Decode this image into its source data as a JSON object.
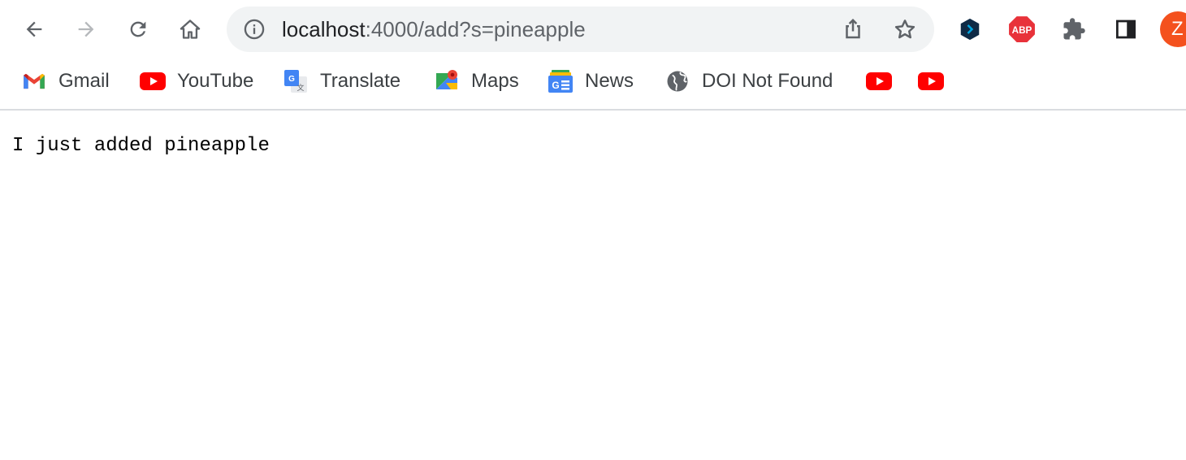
{
  "toolbar": {
    "back_icon": "arrow-left-icon",
    "forward_icon": "arrow-right-icon",
    "reload_icon": "reload-icon",
    "home_icon": "home-icon"
  },
  "omnibox": {
    "host": "localhost",
    "rest": ":4000/add?s=pineapple",
    "icons": [
      "info-icon",
      "share-icon",
      "star-icon"
    ]
  },
  "extensions": {
    "items": [
      "dark-extension-icon",
      "adblock-plus-icon",
      "puzzle-icon",
      "side-panel-icon"
    ],
    "abp_label": "ABP",
    "profile_initial": "Z"
  },
  "bookmarks": {
    "items": [
      {
        "label": "Gmail",
        "icon": "gmail-icon"
      },
      {
        "label": "YouTube",
        "icon": "youtube-icon"
      },
      {
        "label": "Translate",
        "icon": "translate-icon"
      },
      {
        "label": "Maps",
        "icon": "maps-icon"
      },
      {
        "label": "News",
        "icon": "news-icon"
      },
      {
        "label": "DOI Not Found",
        "icon": "globe-icon"
      }
    ],
    "extra_icons": [
      "youtube-icon",
      "youtube-icon"
    ]
  },
  "page": {
    "text": "I just added pineapple"
  },
  "colors": {
    "accent": "#5f6368",
    "youtube_red": "#ff0000",
    "abp_red": "#e8323a",
    "profile_orange": "#f4511e"
  }
}
